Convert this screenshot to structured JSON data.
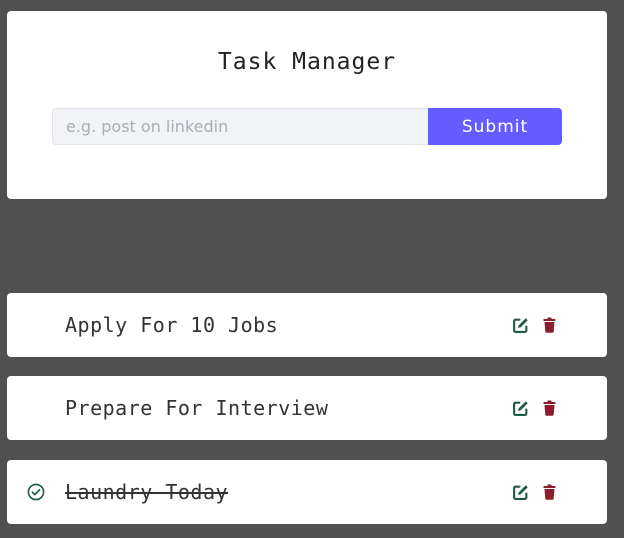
{
  "header": {
    "title": "Task Manager"
  },
  "form": {
    "input_placeholder": "e.g. post on linkedin",
    "input_value": "",
    "submit_label": "Submit"
  },
  "tasks": [
    {
      "name": "Apply For 10 Jobs",
      "completed": false
    },
    {
      "name": "Prepare For Interview",
      "completed": false
    },
    {
      "name": "Laundry Today",
      "completed": true
    }
  ],
  "icons": {
    "edit": "edit-icon",
    "delete": "trash-icon",
    "completed": "check-circle-icon"
  },
  "colors": {
    "background": "#505050",
    "card": "#ffffff",
    "accent": "#645cff",
    "edit_icon": "#1f5a45",
    "delete_icon": "#8b1e2a",
    "check_icon": "#1f5a45"
  }
}
